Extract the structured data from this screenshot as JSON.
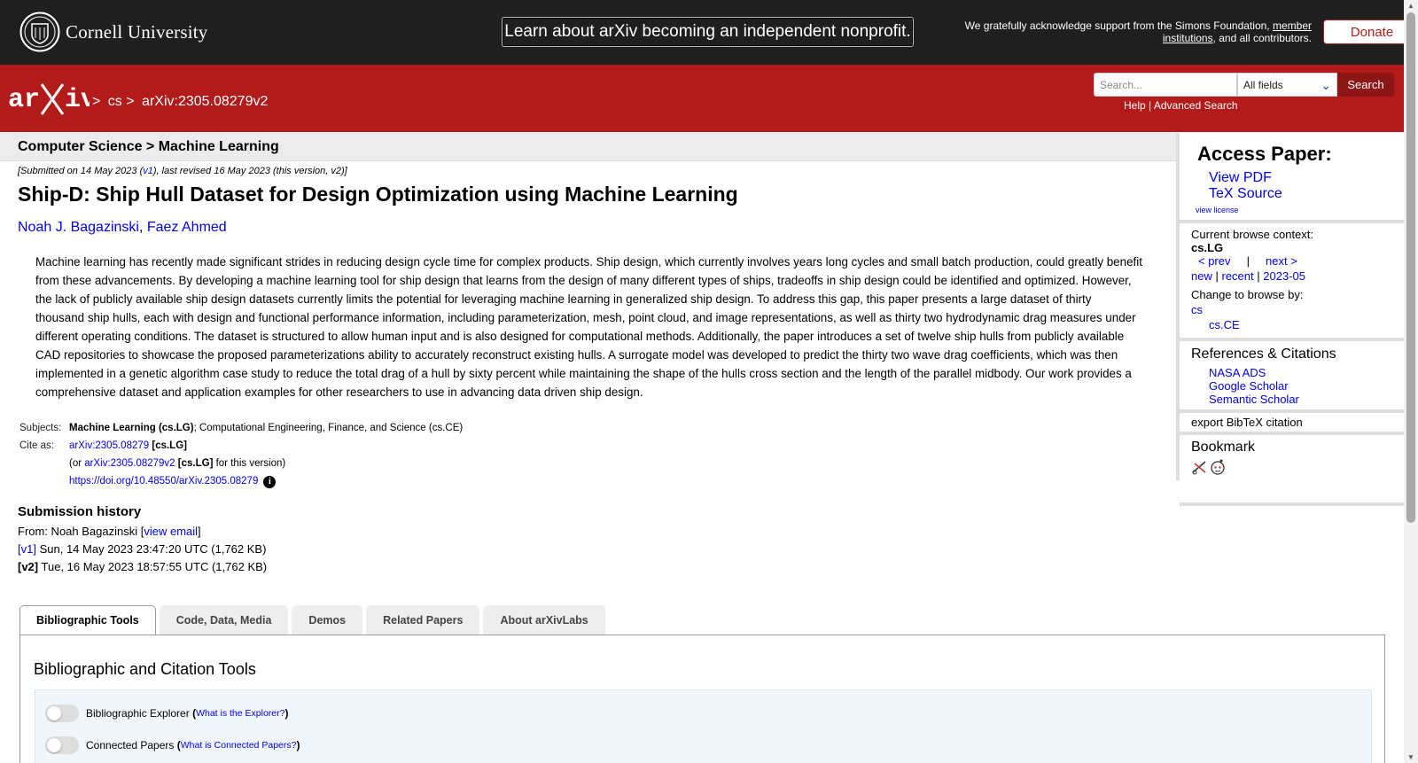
{
  "topbar": {
    "institution": "Cornell University",
    "nonprofit_banner": "Learn about arXiv becoming an independent nonprofit.",
    "ack_prefix": "We gratefully acknowledge support from the Simons Foundation,",
    "ack_link": "member institutions",
    "ack_suffix": ", and all contributors.",
    "donate": "Donate"
  },
  "header": {
    "breadcrumb_sep1": ">",
    "breadcrumb_cs": "cs",
    "breadcrumb_sep2": ">",
    "breadcrumb_id": "arXiv:2305.08279v2",
    "search_placeholder": "Search...",
    "search_field": "All fields",
    "search_button": "Search",
    "help": "Help",
    "sep": "|",
    "advanced": "Advanced Search"
  },
  "subject_heading": "Computer Science > Machine Learning",
  "paper": {
    "date_prefix": "[Submitted on 14 May 2023 (",
    "date_v1": "v1",
    "date_suffix": "), last revised 16 May 2023 (this version, v2)]",
    "title": "Ship-D: Ship Hull Dataset for Design Optimization using Machine Learning",
    "authors": [
      "Noah J. Bagazinski",
      "Faez Ahmed"
    ],
    "author_sep": ",",
    "abstract": "Machine learning has recently made significant strides in reducing design cycle time for complex products. Ship design, which currently involves years long cycles and small batch production, could greatly benefit from these advancements. By developing a machine learning tool for ship design that learns from the design of many different types of ships, tradeoffs in ship design could be identified and optimized. However, the lack of publicly available ship design datasets currently limits the potential for leveraging machine learning in generalized ship design. To address this gap, this paper presents a large dataset of thirty thousand ship hulls, each with design and functional performance information, including parameterization, mesh, point cloud, and image representations, as well as thirty two hydrodynamic drag measures under different operating conditions. The dataset is structured to allow human input and is also designed for computational methods. Additionally, the paper introduces a set of twelve ship hulls from publicly available CAD repositories to showcase the proposed parameterizations ability to accurately reconstruct existing hulls. A surrogate model was developed to predict the thirty two wave drag coefficients, which was then implemented in a genetic algorithm case study to reduce the total drag of a hull by sixty percent while maintaining the shape of the hulls cross section and the length of the parallel midbody. Our work provides a comprehensive dataset and application examples for other researchers to use in advancing data driven ship design."
  },
  "meta": {
    "subjects_label": "Subjects:",
    "subjects_primary": "Machine Learning (cs.LG)",
    "subjects_rest": "; Computational Engineering, Finance, and Science (cs.CE)",
    "cite_label": "Cite as:",
    "cite_id": "arXiv:2305.08279",
    "cite_cat": "[cs.LG]",
    "cite_v_prefix": "(or",
    "cite_v_id": "arXiv:2305.08279v2",
    "cite_v_cat": "[cs.LG]",
    "cite_v_suffix": "for this version)",
    "doi": "https://doi.org/10.48550/arXiv.2305.08279",
    "info_icon": "i"
  },
  "history": {
    "heading": "Submission history",
    "from_prefix": "From: Noah Bagazinski [",
    "from_link": "view email",
    "from_suffix": "]",
    "v1_label": "[v1]",
    "v1_text": "Sun, 14 May 2023 23:47:20 UTC (1,762 KB)",
    "v2_label": "[v2]",
    "v2_text": "Tue, 16 May 2023 18:57:55 UTC (1,762 KB)"
  },
  "sidebar": {
    "access_heading": "Access Paper:",
    "view_pdf": "View PDF",
    "tex_source": "TeX Source",
    "view_license": "view license",
    "context_label": "Current browse context:",
    "context": "cs.LG",
    "prev": "< prev",
    "pipe": "|",
    "next": "next >",
    "new": "new",
    "recent": "recent",
    "month": "2023-05",
    "change_label": "Change to browse by:",
    "cs": "cs",
    "csce": "cs.CE",
    "refs_heading": "References & Citations",
    "nasa": "NASA ADS",
    "google": "Google Scholar",
    "semantic": "Semantic Scholar",
    "bibtex": "export BibTeX citation",
    "bookmark_heading": "Bookmark"
  },
  "tabs": {
    "items": [
      "Bibliographic Tools",
      "Code, Data, Media",
      "Demos",
      "Related Papers",
      "About arXivLabs"
    ],
    "panel_heading": "Bibliographic and Citation Tools",
    "toggle1_label": "Bibliographic Explorer",
    "toggle1_link": "What is the Explorer?",
    "toggle2_label": "Connected Papers",
    "toggle2_link": "What is Connected Papers?",
    "paren_open": "(",
    "paren_close": ")"
  },
  "colors": {
    "arxiv_red": "#b31b1b",
    "topbar": "#1f1f1f",
    "link": "#0000ee"
  }
}
